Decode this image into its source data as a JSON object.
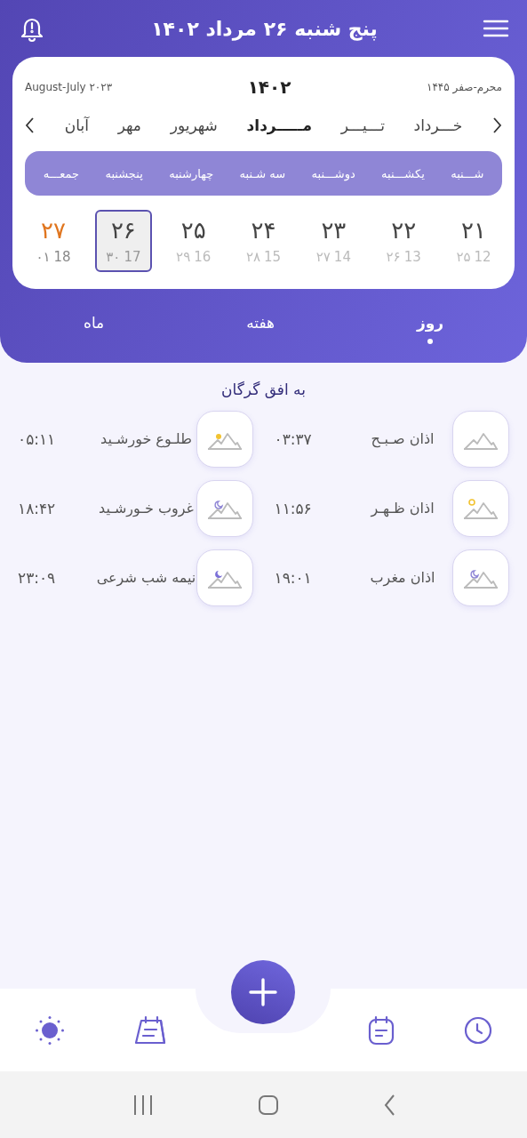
{
  "header": {
    "title": "پنج شنبه ۲۶ مرداد ۱۴۰۲"
  },
  "calendar": {
    "gregorian": "August-July ۲۰۲۳",
    "year": "۱۴۰۲",
    "hijri": "محرم-صفر ۱۴۴۵",
    "months": [
      {
        "label": "خـــرداد",
        "selected": false
      },
      {
        "label": "تـــیـــر",
        "selected": false
      },
      {
        "label": "مـــــرداد",
        "selected": true
      },
      {
        "label": "شهریور",
        "selected": false
      },
      {
        "label": "مهر",
        "selected": false
      },
      {
        "label": "آبان",
        "selected": false
      }
    ],
    "weekdays": [
      "شـــنبه",
      "یکشـــنبه",
      "دوشـــنبه",
      "سه شـنبه",
      "چهارشنبه",
      "پنجشنبه",
      "جمعـــه"
    ],
    "days": [
      {
        "day": "۲۱",
        "gregorian": "12",
        "hijri": "۲۵",
        "selected": false,
        "holiday": false
      },
      {
        "day": "۲۲",
        "gregorian": "13",
        "hijri": "۲۶",
        "selected": false,
        "holiday": false
      },
      {
        "day": "۲۳",
        "gregorian": "14",
        "hijri": "۲۷",
        "selected": false,
        "holiday": false
      },
      {
        "day": "۲۴",
        "gregorian": "15",
        "hijri": "۲۸",
        "selected": false,
        "holiday": false
      },
      {
        "day": "۲۵",
        "gregorian": "16",
        "hijri": "۲۹",
        "selected": false,
        "holiday": false
      },
      {
        "day": "۲۶",
        "gregorian": "17",
        "hijri": "۳۰",
        "selected": true,
        "holiday": false
      },
      {
        "day": "۲۷",
        "gregorian": "18",
        "hijri": "۰۱",
        "selected": false,
        "holiday": true
      }
    ]
  },
  "view_tabs": [
    {
      "label": "روز",
      "selected": true
    },
    {
      "label": "هفته",
      "selected": false
    },
    {
      "label": "ماه",
      "selected": false
    }
  ],
  "location": "به افق گرگان",
  "times": [
    {
      "label": "اذان صـبـح",
      "time": "۰۳:۳۷",
      "kind": "none"
    },
    {
      "label": "طلـوع خورشـید",
      "time": "۰۵:۱۱",
      "kind": "sunrise"
    },
    {
      "label": "اذان ظـهـر",
      "time": "۱۱:۵۶",
      "kind": "sun"
    },
    {
      "label": "غروب خـورشـید",
      "time": "۱۸:۴۲",
      "kind": "moon"
    },
    {
      "label": "اذان مغرب",
      "time": "۱۹:۰۱",
      "kind": "moon"
    },
    {
      "label": "نیمه شب شرعی",
      "time": "۲۳:۰۹",
      "kind": "night"
    }
  ]
}
